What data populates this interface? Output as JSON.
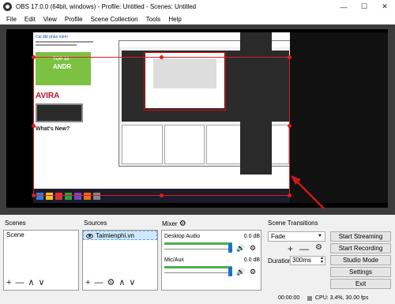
{
  "window": {
    "title": "OBS 17.0.0 (64bit, windows) - Profile: Untitled - Scenes: Untitled",
    "minimize": "—",
    "maximize": "☐",
    "close": "✕"
  },
  "menu": [
    "File",
    "Edit",
    "View",
    "Profile",
    "Scene Collection",
    "Tools",
    "Help"
  ],
  "preview": {
    "wp_link": "Cài đặt phần mềm",
    "top10": "TOP 10",
    "andr": "ANDR",
    "avira": "AVIRA",
    "whats_new": "What's New?"
  },
  "scenes": {
    "title": "Scenes",
    "items": [
      "Scene"
    ],
    "toolbar": [
      "+",
      "—",
      "∧",
      "∨"
    ]
  },
  "sources": {
    "title": "Sources",
    "items": [
      "Taimienphi.vn"
    ],
    "toolbar": [
      "+",
      "—",
      "⚙",
      "∧",
      "∨"
    ]
  },
  "mixer": {
    "title": "Mixer",
    "channels": [
      {
        "name": "Desktop Audio",
        "level": "0.0 dB",
        "volume": 0.97
      },
      {
        "name": "Mic/Aux",
        "level": "0.0 dB",
        "volume": 0.97
      }
    ]
  },
  "transitions": {
    "title": "Scene Transitions",
    "selected": "Fade",
    "duration_label": "Duration",
    "duration_value": "300ms"
  },
  "controls": [
    "Start Streaming",
    "Start Recording",
    "Studio Mode",
    "Settings",
    "Exit"
  ],
  "status": {
    "time": "00:00:00",
    "cpu": "CPU: 3.4%, 30.00 fps"
  },
  "colors": {
    "selection_red": "#e01c1c",
    "mixer_knob": "#1e73c9",
    "meter_green": "#4caf50"
  }
}
